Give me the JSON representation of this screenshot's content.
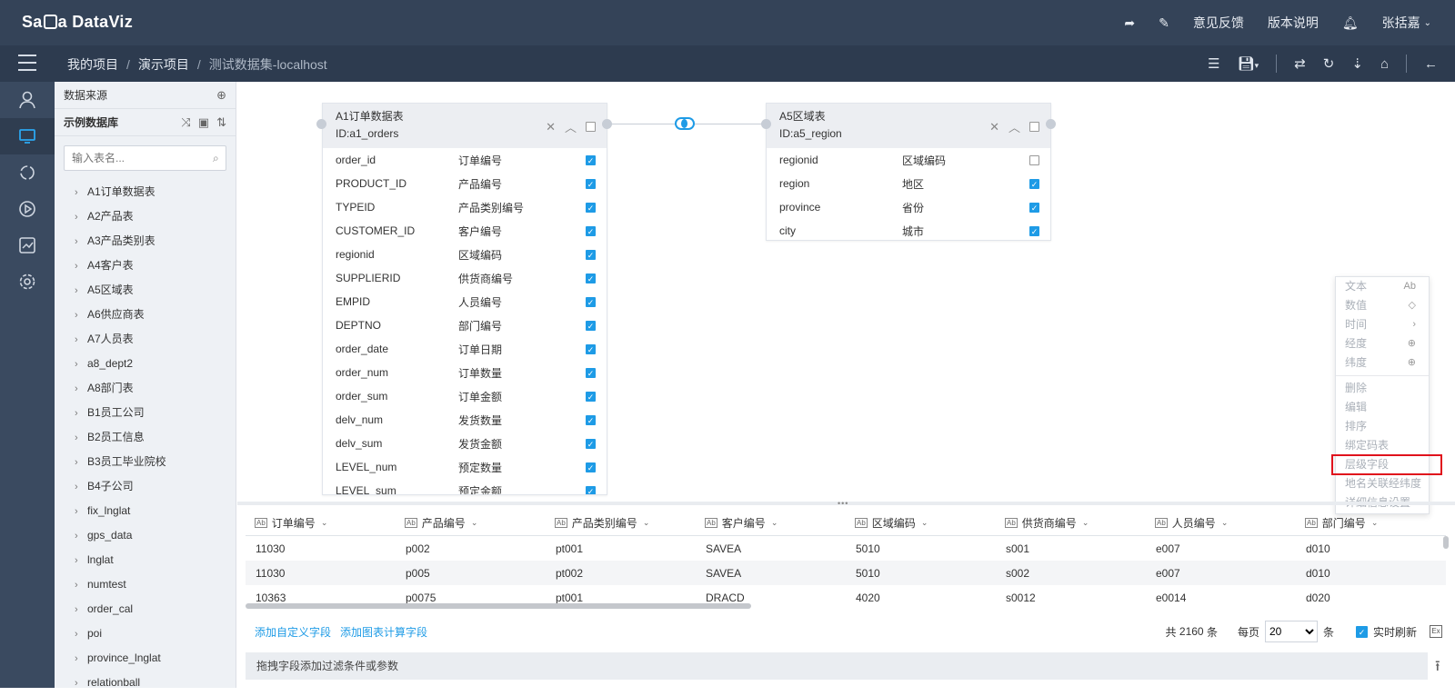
{
  "app": {
    "logo_pre": "Sa",
    "logo_post": "a DataViz",
    "feedback": "意见反馈",
    "version": "版本说明",
    "user": "张括嘉"
  },
  "breadcrumb": [
    "我的项目",
    "演示项目",
    "测试数据集-localhost"
  ],
  "panel": {
    "title": "数据来源",
    "db_label": "示例数据库",
    "search_placeholder": "输入表名...",
    "tables": [
      "A1订单数据表",
      "A2产品表",
      "A3产品类别表",
      "A4客户表",
      "A5区域表",
      "A6供应商表",
      "A7人员表",
      "a8_dept2",
      "A8部门表",
      "B1员工公司",
      "B2员工信息",
      "B3员工毕业院校",
      "B4子公司",
      "fix_lnglat",
      "gps_data",
      "lnglat",
      "numtest",
      "order_cal",
      "poi",
      "province_lnglat",
      "relationball"
    ]
  },
  "table_a1": {
    "title": "A1订单数据表",
    "id": "ID:a1_orders",
    "fields": [
      {
        "name": "order_id",
        "label": "订单编号",
        "checked": true
      },
      {
        "name": "PRODUCT_ID",
        "label": "产品编号",
        "checked": true
      },
      {
        "name": "TYPEID",
        "label": "产品类别编号",
        "checked": true
      },
      {
        "name": "CUSTOMER_ID",
        "label": "客户编号",
        "checked": true
      },
      {
        "name": "regionid",
        "label": "区域编码",
        "checked": true
      },
      {
        "name": "SUPPLIERID",
        "label": "供货商编号",
        "checked": true
      },
      {
        "name": "EMPID",
        "label": "人员编号",
        "checked": true
      },
      {
        "name": "DEPTNO",
        "label": "部门编号",
        "checked": true
      },
      {
        "name": "order_date",
        "label": "订单日期",
        "checked": true
      },
      {
        "name": "order_num",
        "label": "订单数量",
        "checked": true
      },
      {
        "name": "order_sum",
        "label": "订单金额",
        "checked": true
      },
      {
        "name": "delv_num",
        "label": "发货数量",
        "checked": true
      },
      {
        "name": "delv_sum",
        "label": "发货金额",
        "checked": true
      },
      {
        "name": "LEVEL_num",
        "label": "预定数量",
        "checked": true
      },
      {
        "name": "LEVEL_sum",
        "label": "预定金额",
        "checked": true
      }
    ]
  },
  "table_a5": {
    "title": "A5区域表",
    "id": "ID:a5_region",
    "fields": [
      {
        "name": "regionid",
        "label": "区域编码",
        "checked": false
      },
      {
        "name": "region",
        "label": "地区",
        "checked": true
      },
      {
        "name": "province",
        "label": "省份",
        "checked": true
      },
      {
        "name": "city",
        "label": "城市",
        "checked": true
      }
    ]
  },
  "context_menu": {
    "type_items": [
      {
        "label": "文本",
        "icon": "Ab"
      },
      {
        "label": "数值",
        "icon": "◇"
      },
      {
        "label": "时间",
        "icon": "›"
      },
      {
        "label": "经度",
        "icon": "⊕"
      },
      {
        "label": "纬度",
        "icon": "⊕"
      }
    ],
    "action_items": [
      "删除",
      "编辑",
      "排序",
      "绑定码表",
      "层级字段",
      "地名关联经纬度",
      "详细信息设置"
    ],
    "highlighted": "层级字段"
  },
  "grid": {
    "columns": [
      "订单编号",
      "产品编号",
      "产品类别编号",
      "客户编号",
      "区域编码",
      "供货商编号",
      "人员编号",
      "部门编号"
    ],
    "rows": [
      [
        "11030",
        "p002",
        "pt001",
        "SAVEA",
        "5010",
        "s001",
        "e007",
        "d010"
      ],
      [
        "11030",
        "p005",
        "pt002",
        "SAVEA",
        "5010",
        "s002",
        "e007",
        "d010"
      ],
      [
        "10363",
        "p0075",
        "pt001",
        "DRACD",
        "4020",
        "s0012",
        "e0014",
        "d020"
      ]
    ]
  },
  "footer": {
    "add_custom": "添加自定义字段",
    "add_calc": "添加图表计算字段",
    "total_prefix": "共",
    "total": "2160",
    "total_suffix": "条",
    "per_page": "每页",
    "page_size": "20",
    "page_unit": "条",
    "realtime": "实时刷新"
  },
  "filter_hint": "拖拽字段添加过滤条件或参数",
  "colors": {
    "topbar": "#344358",
    "subbar": "#2d3b4f",
    "accent": "#1e9be6",
    "highlight": "#e0121c"
  }
}
